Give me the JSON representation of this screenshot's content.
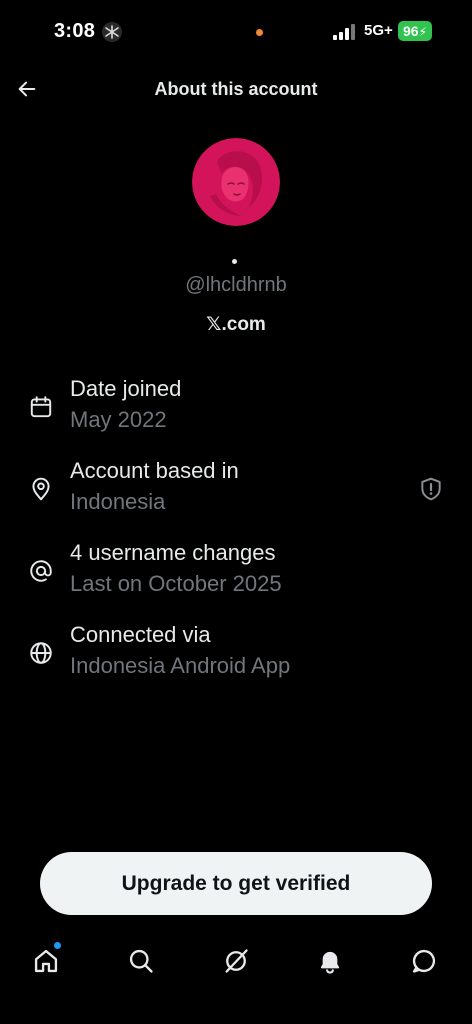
{
  "status_bar": {
    "time": "3:08",
    "network": "5G+",
    "battery": "96",
    "battery_color": "#31c24f",
    "indicator_dot_color": "#f08a30"
  },
  "header": {
    "title": "About this account"
  },
  "profile": {
    "handle": "@lhcldhrnb",
    "site": "𝕏.com",
    "avatar_color": "#d4145a"
  },
  "info": [
    {
      "icon": "calendar-icon",
      "title": "Date joined",
      "subtitle": "May 2022"
    },
    {
      "icon": "location-pin-icon",
      "title": "Account based in",
      "subtitle": "Indonesia"
    },
    {
      "icon": "at-sign-icon",
      "title": "4 username changes",
      "subtitle": "Last on October 2025"
    },
    {
      "icon": "globe-icon",
      "title": "Connected via",
      "subtitle": "Indonesia Android App"
    }
  ],
  "upgrade": {
    "label": "Upgrade to get verified"
  },
  "nav": {
    "items": [
      "home-icon",
      "search-icon",
      "grok-icon",
      "notifications-icon",
      "messages-icon"
    ],
    "badge_color": "#1d9bf0"
  }
}
